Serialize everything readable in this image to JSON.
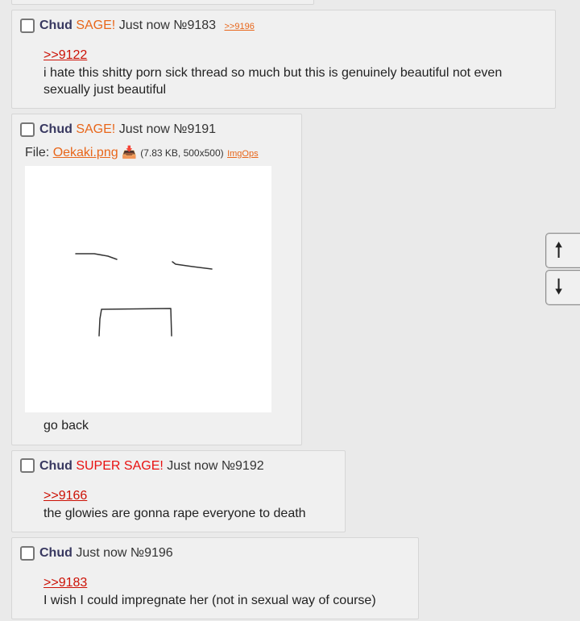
{
  "posts": [
    {
      "name": "Chud",
      "sage": "SAGE!",
      "time": "Just now",
      "number": "№9183",
      "backlink": ">>9196",
      "quote": ">>9122",
      "text": "i hate this shitty porn sick thread so much but this is genuinely beautiful not even sexually just beautiful"
    },
    {
      "name": "Chud",
      "sage": "SAGE!",
      "time": "Just now",
      "number": "№9191",
      "file": {
        "label": "File:",
        "filename": "Oekaki.png",
        "download_icon": "download-tray-icon",
        "info": "(7.83 KB, 500x500)",
        "imgops": "ImgOps"
      },
      "text": "go back"
    },
    {
      "name": "Chud",
      "sage": "SUPER SAGE!",
      "time": "Just now",
      "number": "№9192",
      "quote": ">>9166",
      "text": "the glowies are gonna rape everyone to death"
    },
    {
      "name": "Chud",
      "time": "Just now",
      "number": "№9196",
      "quote": ">>9183",
      "text": "I wish I could impregnate her (not in sexual way of course)"
    }
  ],
  "nav": {
    "up": "🠕",
    "down": "🠗"
  },
  "colors": {
    "background": "#eaeaea",
    "post": "#f0f0f0",
    "name": "#383860",
    "sage": "#e8661a",
    "super_sage": "#e81010",
    "quote": "#cc1105"
  }
}
